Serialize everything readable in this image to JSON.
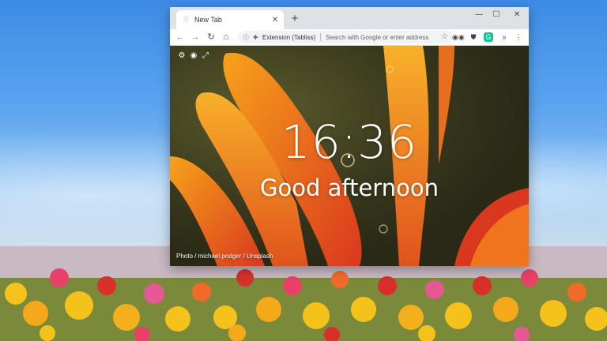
{
  "browser": {
    "tab": {
      "title": "New Tab",
      "close_icon": "close-icon"
    },
    "new_tab_label": "+",
    "window_controls": {
      "minimize": "—",
      "maximize": "☐",
      "close": "✕"
    },
    "toolbar": {
      "back": "←",
      "forward": "→",
      "reload": "↻",
      "home": "⌂",
      "extension_label": "Extension (Tabliss)",
      "search_placeholder": "Search with Google or enter address",
      "star": "☆"
    },
    "extensions": [
      "glasses-icon",
      "shield-icon",
      "grammarly-icon"
    ],
    "overflow_label": "»",
    "menu_label": "⋮"
  },
  "newtab": {
    "time": "16:36",
    "greeting": "Good afternoon",
    "photo_credit": "Photo / michael podger / Unsplash",
    "icons": [
      "settings-icon",
      "eye-icon",
      "expand-icon"
    ]
  },
  "colors": {
    "petal_orange": "#f59a1b",
    "petal_red": "#d9381e",
    "sky": "#4a90e2"
  }
}
